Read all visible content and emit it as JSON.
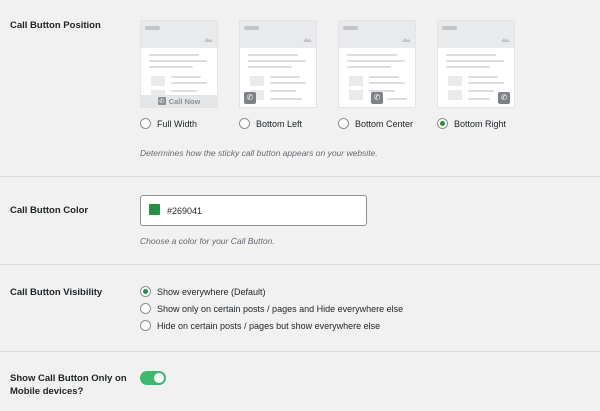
{
  "position": {
    "label": "Call Button Position",
    "full_width_bar_text": "Call Now",
    "options": [
      {
        "label": "Full Width",
        "checked": false
      },
      {
        "label": "Bottom Left",
        "checked": false
      },
      {
        "label": "Bottom Center",
        "checked": false
      },
      {
        "label": "Bottom Right",
        "checked": true
      }
    ],
    "description": "Determines how the sticky call button appears on your website."
  },
  "color": {
    "label": "Call Button Color",
    "value": "#269041",
    "swatch": "#269041",
    "description": "Choose a color for your Call Button."
  },
  "visibility": {
    "label": "Call Button Visibility",
    "options": [
      {
        "label": "Show everywhere (Default)",
        "checked": true
      },
      {
        "label": "Show only on certain posts / pages and Hide everywhere else",
        "checked": false
      },
      {
        "label": "Hide on certain posts / pages but show everywhere else",
        "checked": false
      }
    ]
  },
  "mobile": {
    "label_line1": "Show Call Button Only on",
    "label_line2": "Mobile devices?",
    "enabled": true
  },
  "theme": {
    "accent": "#269041",
    "toggle_on": "#3dba6f"
  },
  "icons": {
    "phone": "phone-icon",
    "image": "image-icon"
  }
}
